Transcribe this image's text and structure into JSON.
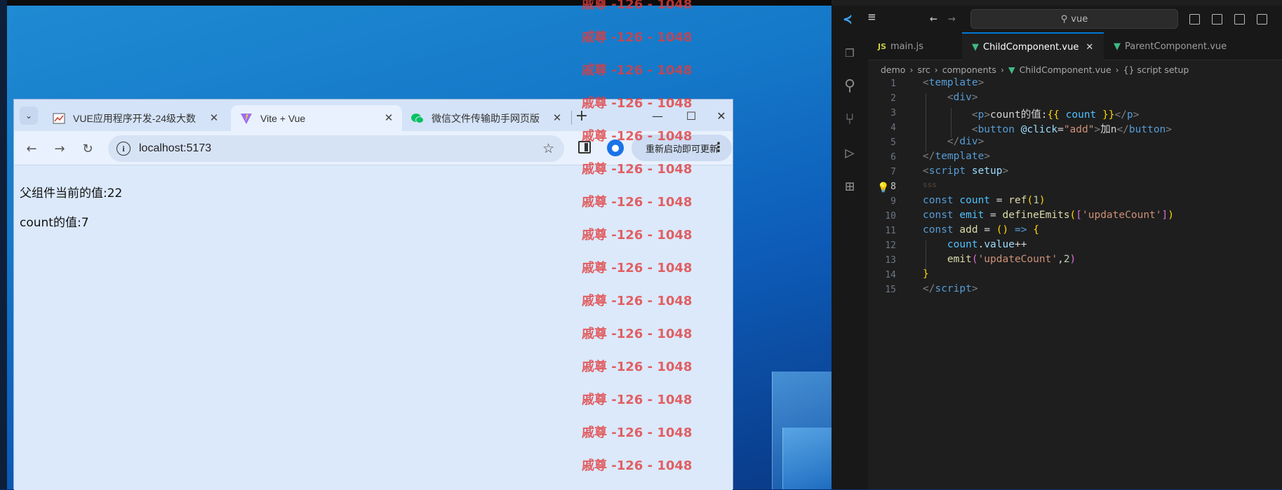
{
  "browser": {
    "tabs": [
      {
        "label": "VUE应用程序开发-24级大数",
        "icon": "chart-icon"
      },
      {
        "label": "Vite + Vue",
        "icon": "vite-icon"
      },
      {
        "label": "微信文件传输助手网页版",
        "icon": "wechat-icon"
      }
    ],
    "url": "localhost:5173",
    "update_button": "重新启动即可更新",
    "content": {
      "line1": "父组件当前的值:22",
      "line2": "count的值:7"
    }
  },
  "watermark": "戚尊 -126 - 1048",
  "vscode": {
    "search": "vue",
    "tabs": [
      {
        "label": "main.js",
        "type": "js"
      },
      {
        "label": "ChildComponent.vue",
        "type": "vue"
      },
      {
        "label": "ParentComponent.vue",
        "type": "vue"
      }
    ],
    "breadcrumb": [
      "demo",
      "src",
      "components",
      "ChildComponent.vue",
      "{} script setup"
    ],
    "line_numbers": [
      "1",
      "2",
      "3",
      "4",
      "5",
      "6",
      "7",
      "8",
      "9",
      "10",
      "11",
      "12",
      "13",
      "14",
      "15"
    ]
  },
  "colors": {
    "vue_green": "#41b883",
    "vscode_accent": "#0078d4",
    "watermark_red": "#e23c3c"
  }
}
